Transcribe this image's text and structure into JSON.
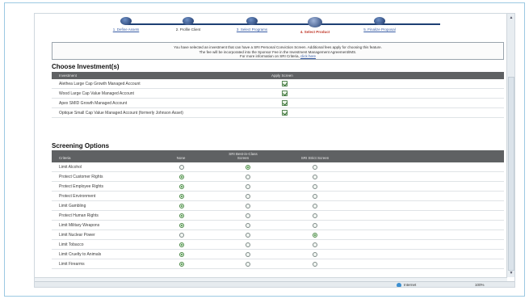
{
  "wizard": {
    "steps": [
      {
        "label": "1. Define Assets",
        "state": "link"
      },
      {
        "label": "2. Profile Client",
        "state": "plain"
      },
      {
        "label": "3. Select Programs",
        "state": "link"
      },
      {
        "label": "4. Select Product",
        "state": "current"
      },
      {
        "label": "5. Finalize Proposal",
        "state": "link"
      }
    ]
  },
  "notice": {
    "line1": "You have selected an investment that can have a SRI Personal Conviction Screen. Additional fees apply for choosing this feature.",
    "line2": "The fee will be incorporated into the Sponsor Fee in the Investment Management Agreement/IMS.",
    "line3_prefix": "For more information on SRI Criteria,",
    "line3_link": "click here"
  },
  "investments": {
    "title": "Choose Investment(s)",
    "headers": {
      "investment": "Investment",
      "apply": "Apply Screen"
    },
    "rows": [
      {
        "label": "Alethea Large Cap Growth Managed Account",
        "checked": true
      },
      {
        "label": "Wood Large Cap Value Managed Account",
        "checked": true
      },
      {
        "label": "Apex SMID Growth Managed Account",
        "checked": true
      },
      {
        "label": "Optique Small Cap Value Managed Account (formerly Johnson Asset)",
        "checked": true
      }
    ]
  },
  "screening": {
    "title": "Screening Options",
    "headers": {
      "criteria": "Criteria",
      "none": "None",
      "best_in_class": "SRI Best-in-Class Screen",
      "strict": "SRI Strict Screen"
    },
    "rows": [
      {
        "label": "Limit Alcohol",
        "selected": "best_in_class"
      },
      {
        "label": "Protect Customer Rights",
        "selected": "none"
      },
      {
        "label": "Protect Employee Rights",
        "selected": "none"
      },
      {
        "label": "Protect Environment",
        "selected": "none"
      },
      {
        "label": "Limit Gambling",
        "selected": "none"
      },
      {
        "label": "Protect Human Rights",
        "selected": "none"
      },
      {
        "label": "Limit Military Weapons",
        "selected": "none"
      },
      {
        "label": "Limit Nuclear Power",
        "selected": "strict"
      },
      {
        "label": "Limit Tobacco",
        "selected": "none"
      },
      {
        "label": "Limit Cruelty to Animals",
        "selected": "none"
      },
      {
        "label": "Limit Firearms",
        "selected": "none"
      }
    ]
  },
  "status": {
    "zone": "Internet",
    "zoom": "100%"
  },
  "colors": {
    "header_bg": "#5f6163",
    "accent_link": "#3a5ea6",
    "current_step": "#c0392b"
  }
}
